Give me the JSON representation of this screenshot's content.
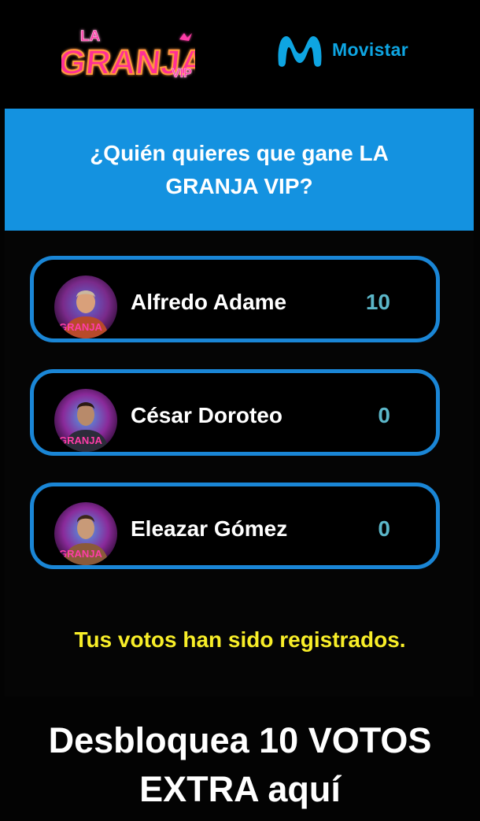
{
  "header": {
    "show_logo_text": "LA GRANJA VIP",
    "sponsor_logo_icon": "movistar-m-icon",
    "sponsor_name": "Movistar"
  },
  "poll": {
    "question": "¿Quién quieres que gane LA GRANJA VIP?",
    "candidates": [
      {
        "name": "Alfredo Adame",
        "votes": "10"
      },
      {
        "name": "César Doroteo",
        "votes": "0"
      },
      {
        "name": "Eleazar Gómez",
        "votes": "0"
      }
    ],
    "status_message": "Tus votos han sido registrados."
  },
  "cta": {
    "label": "Desbloquea 10 VOTOS EXTRA aquí"
  },
  "colors": {
    "banner": "#1492e0",
    "card_border": "#1a86d6",
    "vote_count": "#5bb6c8",
    "status_text": "#f8ee28",
    "brand": "#0ea5e2"
  }
}
